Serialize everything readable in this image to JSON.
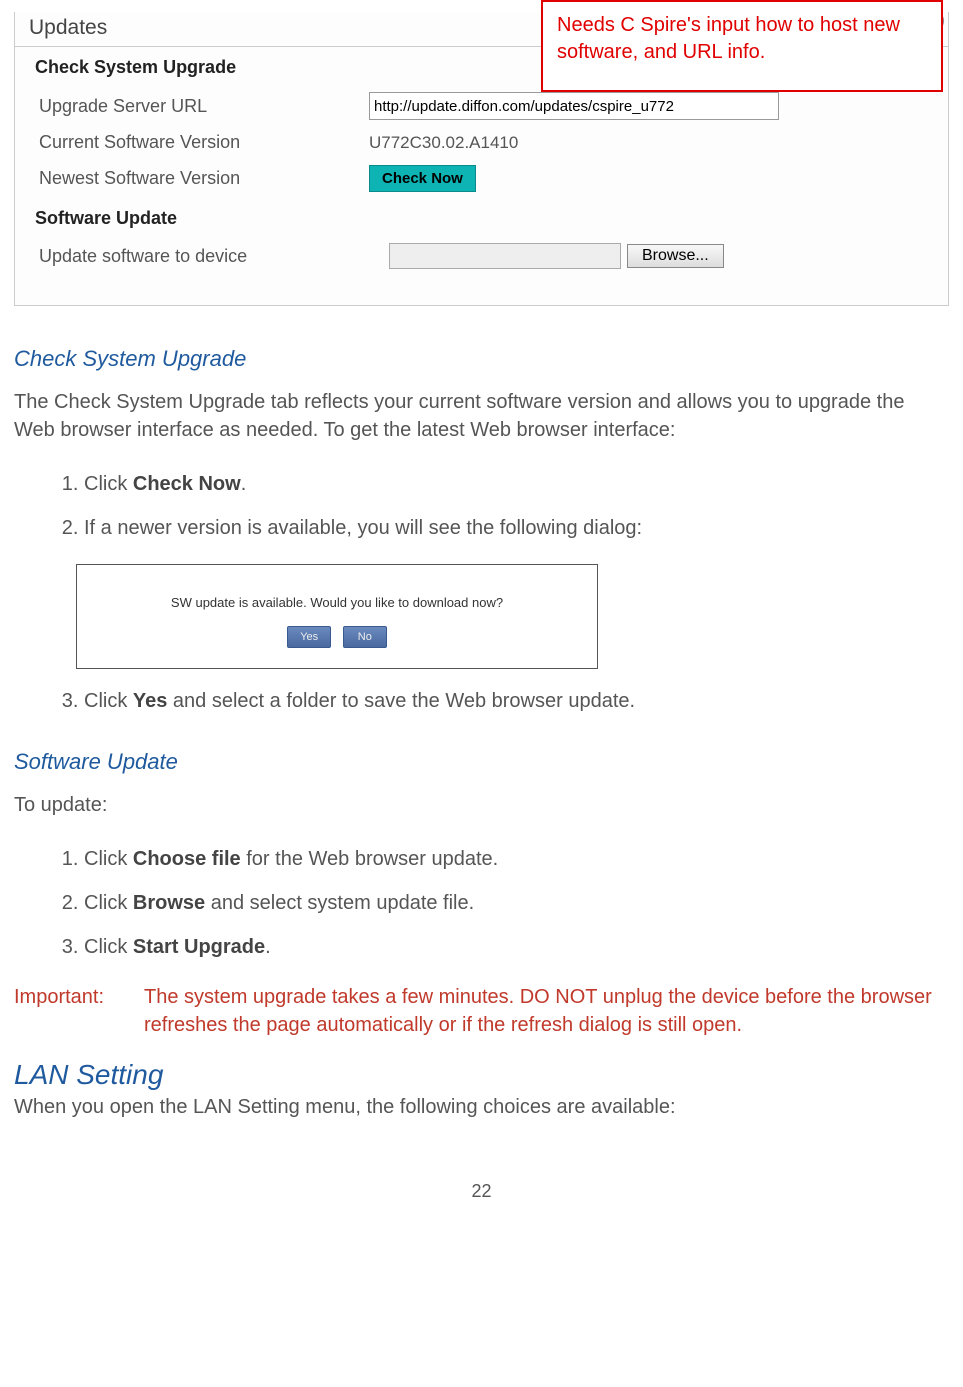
{
  "panel": {
    "tab": "Updates",
    "section1_title": "Check System Upgrade",
    "row_url_label": "Upgrade Server URL",
    "row_url_value": "http://update.diffon.com/updates/cspire_u772",
    "row_curver_label": "Current Software Version",
    "row_curver_value": "U772C30.02.A1410",
    "row_newver_label": "Newest Software Version",
    "check_now_btn": "Check Now",
    "section2_title": "Software Update",
    "row_upload_label": "Update software to device",
    "browse_btn": "Browse..."
  },
  "annotation": "Needs C Spire's input how to host new software, and URL info.",
  "doc": {
    "h3_check": "Check System Upgrade",
    "p_check": "The Check System Upgrade tab reflects your current software version and allows you to upgrade the Web browser interface as needed.  To get the latest Web browser interface:",
    "steps_check": {
      "s1_pre": "Click ",
      "s1_b": "Check Now",
      "s1_post": ".",
      "s2": "If a newer version is available, you will see the following dialog:",
      "s3_pre": "Click ",
      "s3_b": "Yes",
      "s3_post": " and select a folder to save the Web browser update."
    },
    "dialog_msg": "SW update is available. Would you like to download now?",
    "dialog_yes": "Yes",
    "dialog_no": "No",
    "h3_sw": "Software Update",
    "p_sw": "To update:",
    "steps_sw": {
      "s1_pre": "Click ",
      "s1_b": "Choose file",
      "s1_post": " for the Web browser update.",
      "s2_pre": "Click ",
      "s2_b": "Browse",
      "s2_post": " and select system update file.",
      "s3_pre": "Click ",
      "s3_b": "Start Upgrade",
      "s3_post": "."
    },
    "important_label": "Important:",
    "important_text": "The system upgrade takes a few minutes. DO NOT unplug the device before the browser refreshes the page automatically or if the refresh dialog is still open.",
    "h2_lan": "LAN Setting",
    "p_lan": "When you open the LAN Setting menu, the following choices are available:",
    "page_num": "22"
  }
}
